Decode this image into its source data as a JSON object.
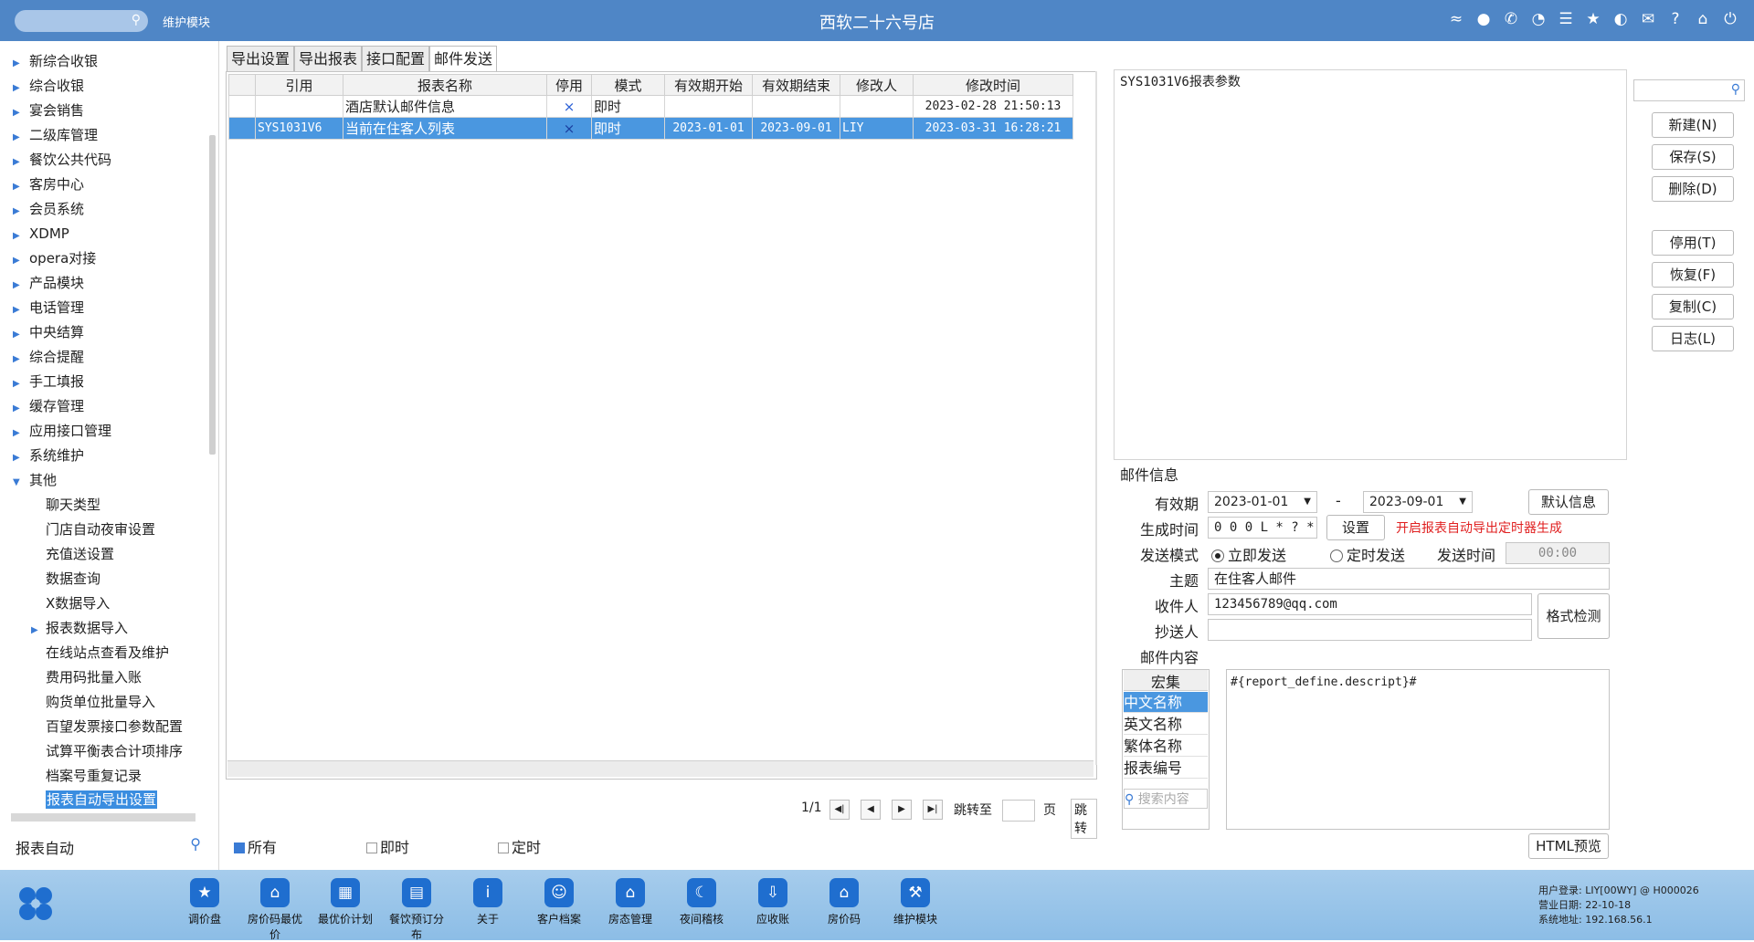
{
  "header": {
    "module_label": "维护模块",
    "title": "西软二十六号店",
    "icons": [
      "wifi-icon",
      "message-icon",
      "phone-icon",
      "palette-icon",
      "menu-icon",
      "star-icon",
      "theme-icon",
      "mail-icon",
      "help-icon",
      "home-icon",
      "power-icon"
    ]
  },
  "sidebar": {
    "items": [
      {
        "label": "新综合收银"
      },
      {
        "label": "综合收银"
      },
      {
        "label": "宴会销售"
      },
      {
        "label": "二级库管理"
      },
      {
        "label": "餐饮公共代码"
      },
      {
        "label": "客房中心"
      },
      {
        "label": "会员系统"
      },
      {
        "label": "XDMP"
      },
      {
        "label": "opera对接"
      },
      {
        "label": "产品模块"
      },
      {
        "label": "电话管理"
      },
      {
        "label": "中央结算"
      },
      {
        "label": "综合提醒"
      },
      {
        "label": "手工填报"
      },
      {
        "label": "缓存管理"
      },
      {
        "label": "应用接口管理"
      },
      {
        "label": "系统维护"
      },
      {
        "label": "其他"
      }
    ],
    "sub_items": [
      {
        "label": "聊天类型"
      },
      {
        "label": "门店自动夜审设置"
      },
      {
        "label": "充值送设置"
      },
      {
        "label": "数据查询"
      },
      {
        "label": "X数据导入"
      },
      {
        "label": "报表数据导入"
      },
      {
        "label": "在线站点查看及维护"
      },
      {
        "label": "费用码批量入账"
      },
      {
        "label": "购货单位批量导入"
      },
      {
        "label": "百望发票接口参数配置"
      },
      {
        "label": "试算平衡表合计项排序"
      },
      {
        "label": "档案号重复记录"
      },
      {
        "label": "报表自动导出设置"
      }
    ],
    "search_value": "报表自动"
  },
  "tabs": [
    {
      "label": "导出设置"
    },
    {
      "label": "导出报表"
    },
    {
      "label": "接口配置"
    },
    {
      "label": "邮件发送"
    }
  ],
  "grid": {
    "columns": [
      "引用",
      "报表名称",
      "停用",
      "模式",
      "有效期开始",
      "有效期结束",
      "修改人",
      "修改时间"
    ],
    "rows": [
      {
        "ref": "",
        "name": "酒店默认邮件信息",
        "stop": "×",
        "mode": "即时",
        "start": "",
        "end": "",
        "modifier": "",
        "time": "2023-02-28 21:50:13"
      },
      {
        "ref": "SYS1031V6",
        "name": "当前在住客人列表",
        "stop": "×",
        "mode": "即时",
        "start": "2023-01-01",
        "end": "2023-09-01",
        "modifier": "LIY",
        "time": "2023-03-31 16:28:21"
      }
    ]
  },
  "pager": {
    "page_info": "1/1",
    "jump_label": "跳转至",
    "page_unit": "页",
    "jump_button": "跳转"
  },
  "filters": {
    "all": "所有",
    "instant": "即时",
    "scheduled": "定时"
  },
  "right": {
    "params_title": "SYS1031V6报表参数",
    "buttons": {
      "new": "新建(N)",
      "save": "保存(S)",
      "delete": "删除(D)",
      "disable": "停用(T)",
      "restore": "恢复(F)",
      "copy": "复制(C)",
      "log": "日志(L)"
    },
    "mail": {
      "section_title": "邮件信息",
      "validity_label": "有效期",
      "start_date": "2023-01-01",
      "dash": "-",
      "end_date": "2023-09-01",
      "default_button": "默认信息",
      "gen_time_label": "生成时间",
      "gen_time_value": "0 0 0 L * ? *",
      "set_button": "设置",
      "timer_hint": "开启报表自动导出定时器生成",
      "send_mode_label": "发送模式",
      "mode_instant": "立即发送",
      "mode_scheduled": "定时发送",
      "send_time_label": "发送时间",
      "send_time_value": "00:00",
      "subject_label": "主题",
      "subject_value": "在住客人邮件",
      "recipient_label": "收件人",
      "recipient_value": "123456789@qq.com",
      "format_check_button": "格式检测",
      "cc_label": "抄送人",
      "cc_value": "",
      "content_label": "邮件内容",
      "macro_header": "宏集",
      "macros": [
        "中文名称",
        "英文名称",
        "繁体名称",
        "报表编号"
      ],
      "macro_search_placeholder": "搜索内容",
      "content_value": "#{report_define.descript}#",
      "html_preview_button": "HTML预览"
    }
  },
  "bottom": {
    "items": [
      {
        "label": "调价盘",
        "icon": "price-adjust-icon"
      },
      {
        "label": "房价码最优价",
        "icon": "room-rate-icon"
      },
      {
        "label": "最优价计划",
        "icon": "best-price-plan-icon"
      },
      {
        "label": "餐饮预订分布",
        "icon": "dining-booking-icon"
      },
      {
        "label": "关于",
        "icon": "info-icon"
      },
      {
        "label": "客户档案",
        "icon": "customer-profile-icon"
      },
      {
        "label": "房态管理",
        "icon": "room-status-icon"
      },
      {
        "label": "夜间稽核",
        "icon": "night-audit-icon"
      },
      {
        "label": "应收账",
        "icon": "receivable-icon"
      },
      {
        "label": "房价码",
        "icon": "rate-code-icon"
      },
      {
        "label": "维护模块",
        "icon": "maintenance-icon"
      }
    ],
    "user_login": "用户登录:  LIY[00WY] @ H000026",
    "business_date": "营业日期:  22-10-18",
    "system_address": "系统地址:  192.168.56.1"
  }
}
